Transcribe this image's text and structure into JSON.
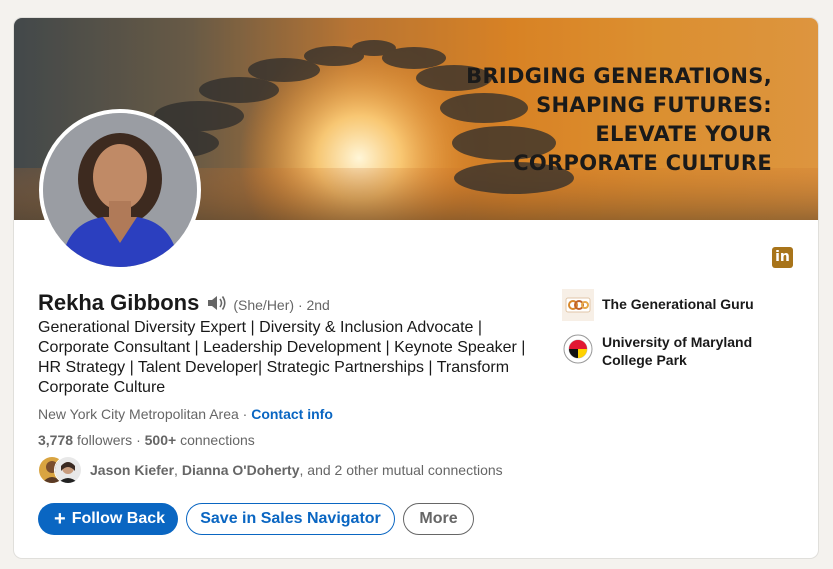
{
  "banner": {
    "lines": [
      "BRIDGING GENERATIONS,",
      "SHAPING FUTURES:",
      "ELEVATE YOUR",
      "CORPORATE CULTURE"
    ]
  },
  "profile": {
    "name": "Rekha Gibbons",
    "pronouns": "(She/Her)",
    "degree": "· 2nd",
    "headline": "Generational Diversity Expert | Diversity & Inclusion Advocate | Corporate Consultant | Leadership Development | Keynote Speaker | HR Strategy | Talent Developer| Strategic Partnerships | Transform Corporate Culture",
    "location": "New York City Metropolitan Area",
    "location_sep": " · ",
    "contact_info": "Contact info",
    "followers_count": "3,778",
    "followers_label": "followers",
    "connections_sep": " · ",
    "connections_count": "500+",
    "connections_label": "connections"
  },
  "mutual": {
    "name1": "Jason Kiefer",
    "sep": ", ",
    "name2": "Dianna O'Doherty",
    "rest": ", and 2 other mutual connections"
  },
  "actions": {
    "follow_back": "Follow Back",
    "sales_navigator": "Save in Sales Navigator",
    "more": "More"
  },
  "experience": [
    {
      "name": "The Generational Guru"
    },
    {
      "name": "University of Maryland College Park"
    }
  ],
  "icons": {
    "linkedin": "linkedin-icon",
    "speaker": "speaker-icon",
    "plus": "plus-icon"
  },
  "colors": {
    "accent": "#0a66c2",
    "linkedin_badge": "#a8741a"
  }
}
